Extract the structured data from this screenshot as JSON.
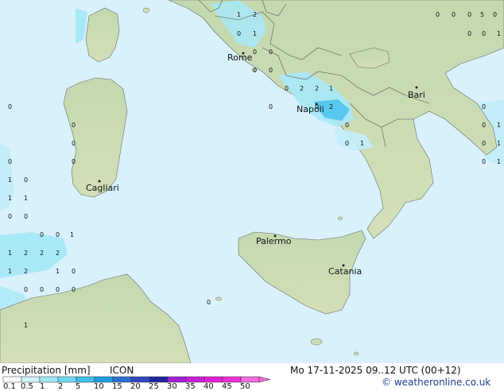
{
  "map": {
    "cities": [
      {
        "name": "Rome"
      },
      {
        "name": "Napoli"
      },
      {
        "name": "Bari"
      },
      {
        "name": "Cagliari"
      },
      {
        "name": "Palermo"
      },
      {
        "name": "Catania"
      }
    ],
    "precip_numbers": [
      "1",
      "2",
      "0",
      "1",
      "0",
      "0",
      "0",
      "0",
      "0",
      "0",
      "0",
      "5",
      "0",
      "0",
      "0",
      "1",
      "0",
      "2",
      "2",
      "1",
      "0",
      "2",
      "0",
      "0",
      "0",
      "0",
      "1",
      "0",
      "1",
      "0",
      "1",
      "0",
      "1",
      "0",
      "1",
      "0",
      "1",
      "0",
      "1",
      "0",
      "0",
      "0",
      "0",
      "1",
      "1",
      "2",
      "2",
      "2",
      "1",
      "2",
      "1",
      "0",
      "0",
      "0",
      "0",
      "0",
      "1",
      "0",
      "0",
      "0",
      "0"
    ]
  },
  "footer": {
    "title": "Precipitation [mm]",
    "model": "ICON",
    "datetime": "Mo 17-11-2025 09..12 UTC (00+12)",
    "credit": "© weatheronline.co.uk"
  },
  "scale": {
    "labels": [
      "0.1",
      "0.5",
      "1",
      "2",
      "5",
      "10",
      "15",
      "20",
      "25",
      "30",
      "35",
      "40",
      "45",
      "50"
    ],
    "colors": [
      "#ffffff",
      "#d0f5fc",
      "#9fe8f6",
      "#6fd7f0",
      "#3ebfe8",
      "#1f9be0",
      "#2a6fd6",
      "#2f45c2",
      "#1f24a0",
      "#a51fd4",
      "#c81fd8",
      "#e31fd6",
      "#f02fd6",
      "#f56ae0"
    ]
  },
  "colors": {
    "sea": "#d9f1fb",
    "land": "#c9ddb6",
    "precip_light": "#a8e9f8",
    "precip_medium": "#58c8ef"
  }
}
